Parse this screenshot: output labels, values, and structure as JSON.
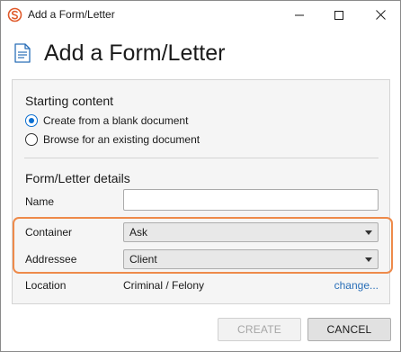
{
  "window": {
    "title": "Add a Form/Letter",
    "icon": "app-logo-icon"
  },
  "header": {
    "title": "Add a Form/Letter",
    "icon": "document-icon"
  },
  "starting_content": {
    "heading": "Starting content",
    "options": [
      {
        "label": "Create from a blank document",
        "selected": true
      },
      {
        "label": "Browse for an existing document",
        "selected": false
      }
    ]
  },
  "details": {
    "heading": "Form/Letter details",
    "name_label": "Name",
    "name_value": "",
    "container_label": "Container",
    "container_value": "Ask",
    "addressee_label": "Addressee",
    "addressee_value": "Client",
    "location_label": "Location",
    "location_value": "Criminal / Felony",
    "change_link": "change..."
  },
  "footer": {
    "create_label": "CREATE",
    "create_enabled": false,
    "cancel_label": "CANCEL"
  },
  "colors": {
    "accent": "#0a6ed1",
    "highlight": "#ee8a4a",
    "link": "#2a6fb8",
    "logo": "#e05a2b"
  }
}
